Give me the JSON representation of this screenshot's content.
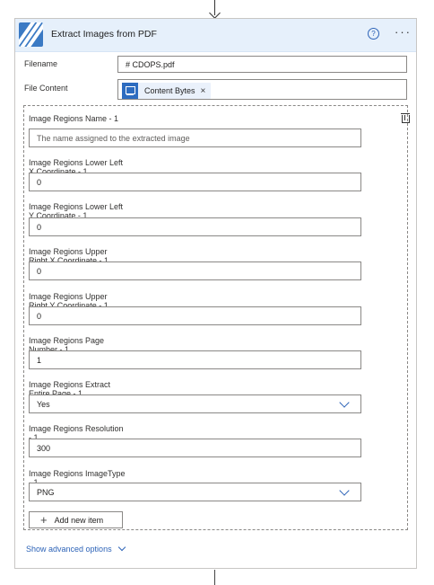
{
  "card": {
    "title": "Extract Images from PDF",
    "help_icon_glyph": "?",
    "more_icon_glyph": "···"
  },
  "fields": {
    "filename": {
      "label": "Filename",
      "value": "# CDOPS.pdf"
    },
    "file_content": {
      "label": "File Content",
      "token_label": "Content Bytes",
      "token_close": "×"
    }
  },
  "image_regions": [
    {
      "label": "Image Regions Name - 1",
      "value": "The name assigned to the extracted image",
      "placeholder": true
    },
    {
      "label": "Image Regions Lower Left X Coordinate - 1",
      "value": "0"
    },
    {
      "label": "Image Regions Lower Left Y Coordinate - 1",
      "value": "0"
    },
    {
      "label": "Image Regions Upper Right X Coordinate - 1",
      "value": "0"
    },
    {
      "label": "Image Regions Upper Right Y Coordinate - 1",
      "value": "0"
    },
    {
      "label": "Image Regions Page Number - 1",
      "value": "1"
    },
    {
      "label": "Image Regions Extract Entire Page - 1",
      "value": "Yes",
      "dropdown": true
    },
    {
      "label": "Image Regions Resolution - 1",
      "value": "300"
    },
    {
      "label": "Image Regions ImageType - 1",
      "value": "PNG",
      "dropdown": true
    }
  ],
  "add_item": {
    "plus": "+",
    "label": "Add new item"
  },
  "advanced": {
    "label": "Show advanced options"
  },
  "colors": {
    "accent": "#2e64b8",
    "header_bg": "#e6f0fb",
    "app_icon": "#3b7ac4"
  }
}
